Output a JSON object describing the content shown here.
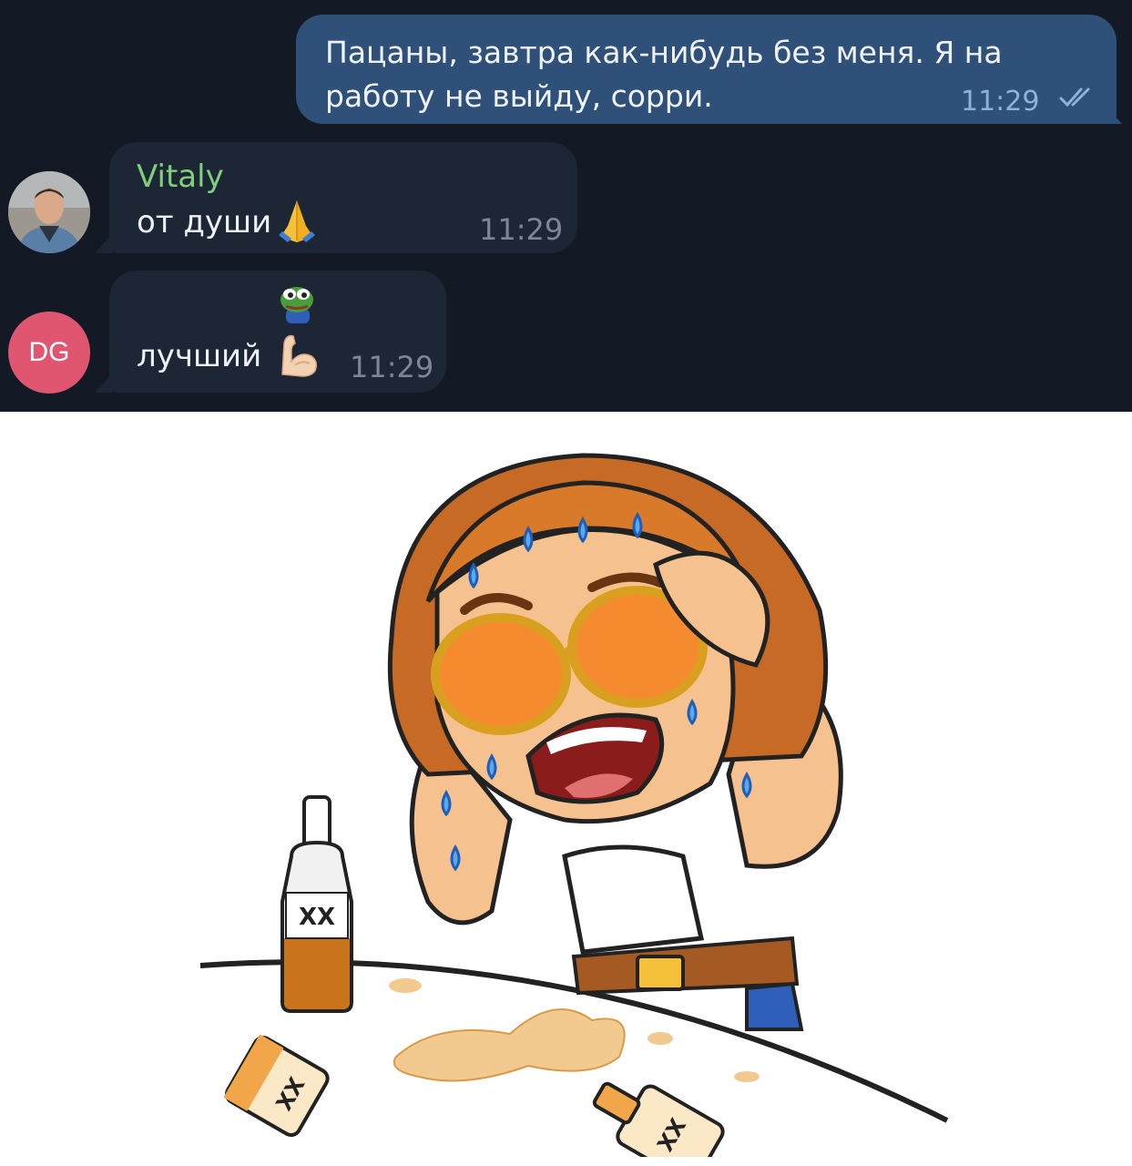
{
  "messages": {
    "outgoing": {
      "text": "Пацаны, завтра как-нибудь без меня. Я на работу не выйду, сорри.",
      "time": "11:29",
      "status": "read"
    },
    "vitaly": {
      "sender": "Vitaly",
      "text": "от души",
      "emoji": "folded-hands",
      "time": "11:29"
    },
    "dg": {
      "avatar_initials": "DG",
      "text": "лучший",
      "emoji": "flexed-biceps",
      "time": "11:29"
    }
  },
  "colors": {
    "chat_bg": "#131a26",
    "outgoing_bubble": "#2f5079",
    "incoming_bubble": "#1d2634",
    "sender_name": "#7fd07a",
    "avatar_dg": "#e0556f"
  },
  "sticker": {
    "bottle_label": "XX",
    "icon": "hungover-man-sticker"
  }
}
